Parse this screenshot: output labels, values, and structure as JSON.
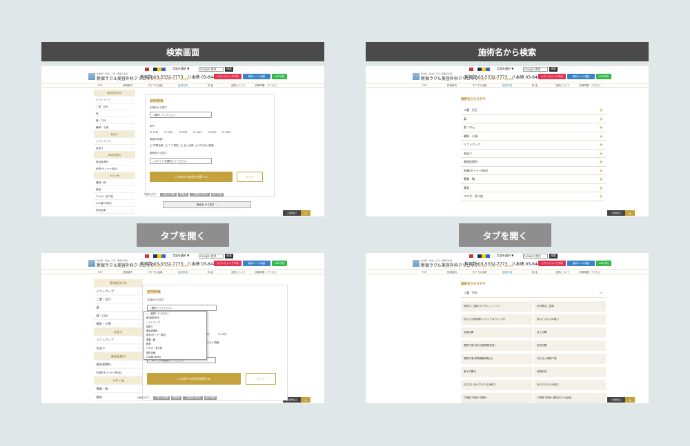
{
  "labels": {
    "search_screen": "検索画面",
    "search_by_name": "施術名から検索",
    "open_tab_left": "タブを開く",
    "open_tab_right": "タブを開く"
  },
  "site": {
    "clinic_small": "新宿院・新宿二丁目・御徒町本院",
    "clinic": "新宿ラクル美容外科クリニック",
    "tel": "新宿院 03-5332-7773　八本崎 03-6441-3355",
    "tel_sub": "受付時間：10:00〜19:00（年中無休）",
    "btn_counsel": "カウンセリング予約",
    "btn_mail": "無料メール相談",
    "btn_line": "LINE予約",
    "google_select": "言語を選択 ▼",
    "google_search": "Google 提供",
    "google_btn": "検索",
    "nav": [
      "TOP",
      "診療案内",
      "ホテ下の治療",
      "症例写真",
      "料 金",
      "当院について",
      "診療時間・アクセス"
    ],
    "nav_active": "症例写真",
    "float_btn": "ご質問窓口",
    "float_top": "▲"
  },
  "search": {
    "title": "症例検索",
    "from_area": "お悩みから探す",
    "area_ph": "--選択してください--",
    "age": "年代",
    "ages": [
      "10代",
      "20代",
      "30代",
      "40代",
      "50代",
      "60代"
    ],
    "scar": "施術の特徴：",
    "features": [
      "早期治療",
      "アフ傷型",
      "全入治療",
      "切らない脱脂"
    ],
    "from_treat": "施術名から探す",
    "treat_ph": "--カテゴリを選択してください--",
    "submit": "この条件で症例を検索する",
    "clear": "クリア",
    "tags_label": "人気のタグ：",
    "tags": [
      "二重(全切開)",
      "鼻整形",
      "二重整形(埋没)",
      "眉下切開"
    ],
    "treat_btn": "施術名 から探す"
  },
  "sidebar": [
    {
      "cat": "顔(美容外科)"
    },
    {
      "item": "リフトアップ"
    },
    {
      "item": "二重・目元"
    },
    {
      "item": "鼻"
    },
    {
      "item": "唇・口元"
    },
    {
      "item": "輪郭・小顔"
    },
    {
      "cat": "若返り"
    },
    {
      "item": "リフトアップ"
    },
    {
      "item": "若返り"
    },
    {
      "cat": "美容皮膚科"
    },
    {
      "item": "美容皮膚科"
    },
    {
      "item": "刺青(タトゥー除去)"
    },
    {
      "cat": "ボディ他"
    },
    {
      "item": "豊胸・胸"
    },
    {
      "item": "痩身"
    },
    {
      "item": "ワキガ・多汗症"
    },
    {
      "item": "OG(婦人科系)"
    },
    {
      "item": "男性治療"
    }
  ],
  "dropdown": [
    "✓ --選択してください--",
    "顔(美容外科)",
    "リフトアップ",
    "若返り",
    "美容皮膚科",
    "刺青(タトゥー除去)",
    "豊胸・胸",
    "痩身",
    "ワキガ・多汗症",
    "男性治療",
    "OG(婦人科系)"
  ],
  "byname": {
    "heading": "施術名からさがす",
    "items": [
      "二重・目元",
      "鼻",
      "唇・口元",
      "輪郭・小顔",
      "リフトアップ",
      "若返り",
      "美容皮膚科",
      "刺青(タトゥー除去)",
      "豊胸・胸",
      "痩身",
      "ワキガ・多汗症"
    ],
    "opened": "二重・目元",
    "sub": [
      "埋没法二重術(エクセレントアイ)",
      "全切開法二重術",
      "目の上の脂肪取り(マイクロカット法)",
      "目の上のたるみ取り",
      "目頭切開",
      "目上切開",
      "眼瞼下垂手術(目頭調整併用)",
      "目尻切開",
      "眼瞼下垂(挙筋腱膜前転法)",
      "切らない眼瞼下垂",
      "眉下切開法",
      "涙袋形成",
      "切らない目の下のたるみ取り",
      "目の下のたるみ取り",
      "下眼瞼下制術 切開法",
      "下眼瞼下制術 埋没法(たれ目術)"
    ]
  }
}
